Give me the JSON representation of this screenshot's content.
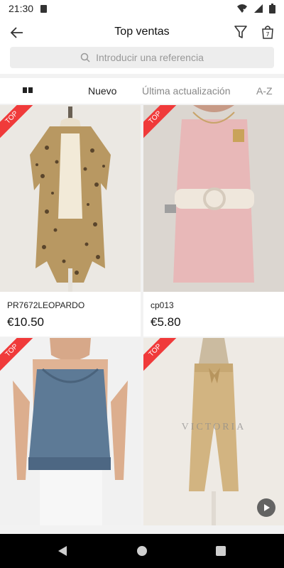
{
  "status": {
    "time": "21:30"
  },
  "header": {
    "title": "Top ventas"
  },
  "search": {
    "placeholder": "Introducir una referencia"
  },
  "sort": {
    "options": [
      "Nuevo",
      "Última actualización",
      "A-Z"
    ],
    "active": "Nuevo"
  },
  "products": [
    {
      "ribbon": "TOP",
      "sku": "PR7672LEOPARDO",
      "price": "€10.50"
    },
    {
      "ribbon": "TOP",
      "sku": "cp013",
      "price": "€5.80"
    },
    {
      "ribbon": "TOP",
      "sku": "",
      "price": ""
    },
    {
      "ribbon": "TOP",
      "sku": "",
      "price": ""
    }
  ],
  "watermark": "VICTORIA",
  "colors": {
    "ribbon": "#f03a3a",
    "accent": "#222222"
  }
}
